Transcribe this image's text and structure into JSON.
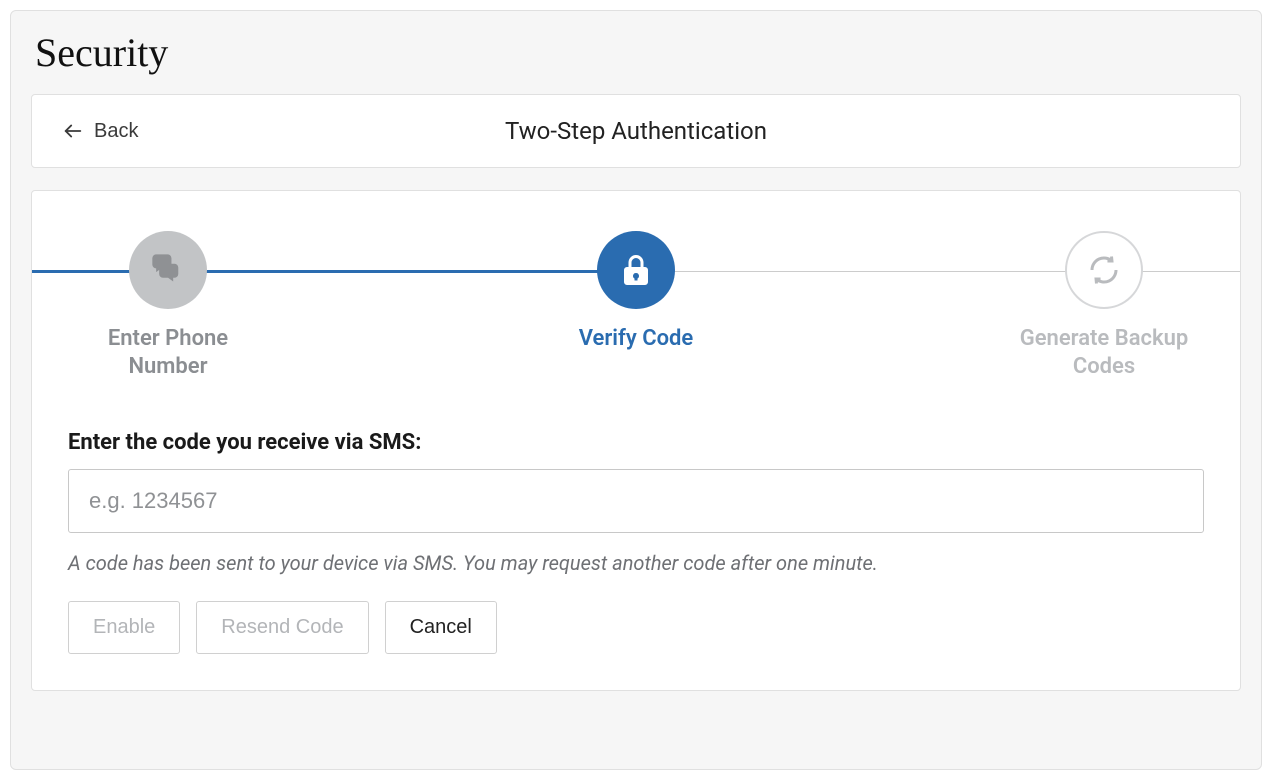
{
  "page": {
    "title": "Security"
  },
  "header": {
    "back_label": "Back",
    "title": "Two-Step Authentication"
  },
  "stepper": {
    "steps": [
      {
        "label": "Enter Phone Number",
        "state": "completed",
        "icon": "chat-icon"
      },
      {
        "label": "Verify Code",
        "state": "active",
        "icon": "lock-icon"
      },
      {
        "label": "Generate Backup Codes",
        "state": "pending",
        "icon": "refresh-icon"
      }
    ]
  },
  "form": {
    "label": "Enter the code you receive via SMS:",
    "code_placeholder": "e.g. 1234567",
    "code_value": "",
    "hint": "A code has been sent to your device via SMS. You may request another code after one minute."
  },
  "buttons": {
    "enable": "Enable",
    "resend": "Resend Code",
    "cancel": "Cancel"
  },
  "colors": {
    "accent": "#2a6cb0",
    "muted": "#8f9194"
  }
}
